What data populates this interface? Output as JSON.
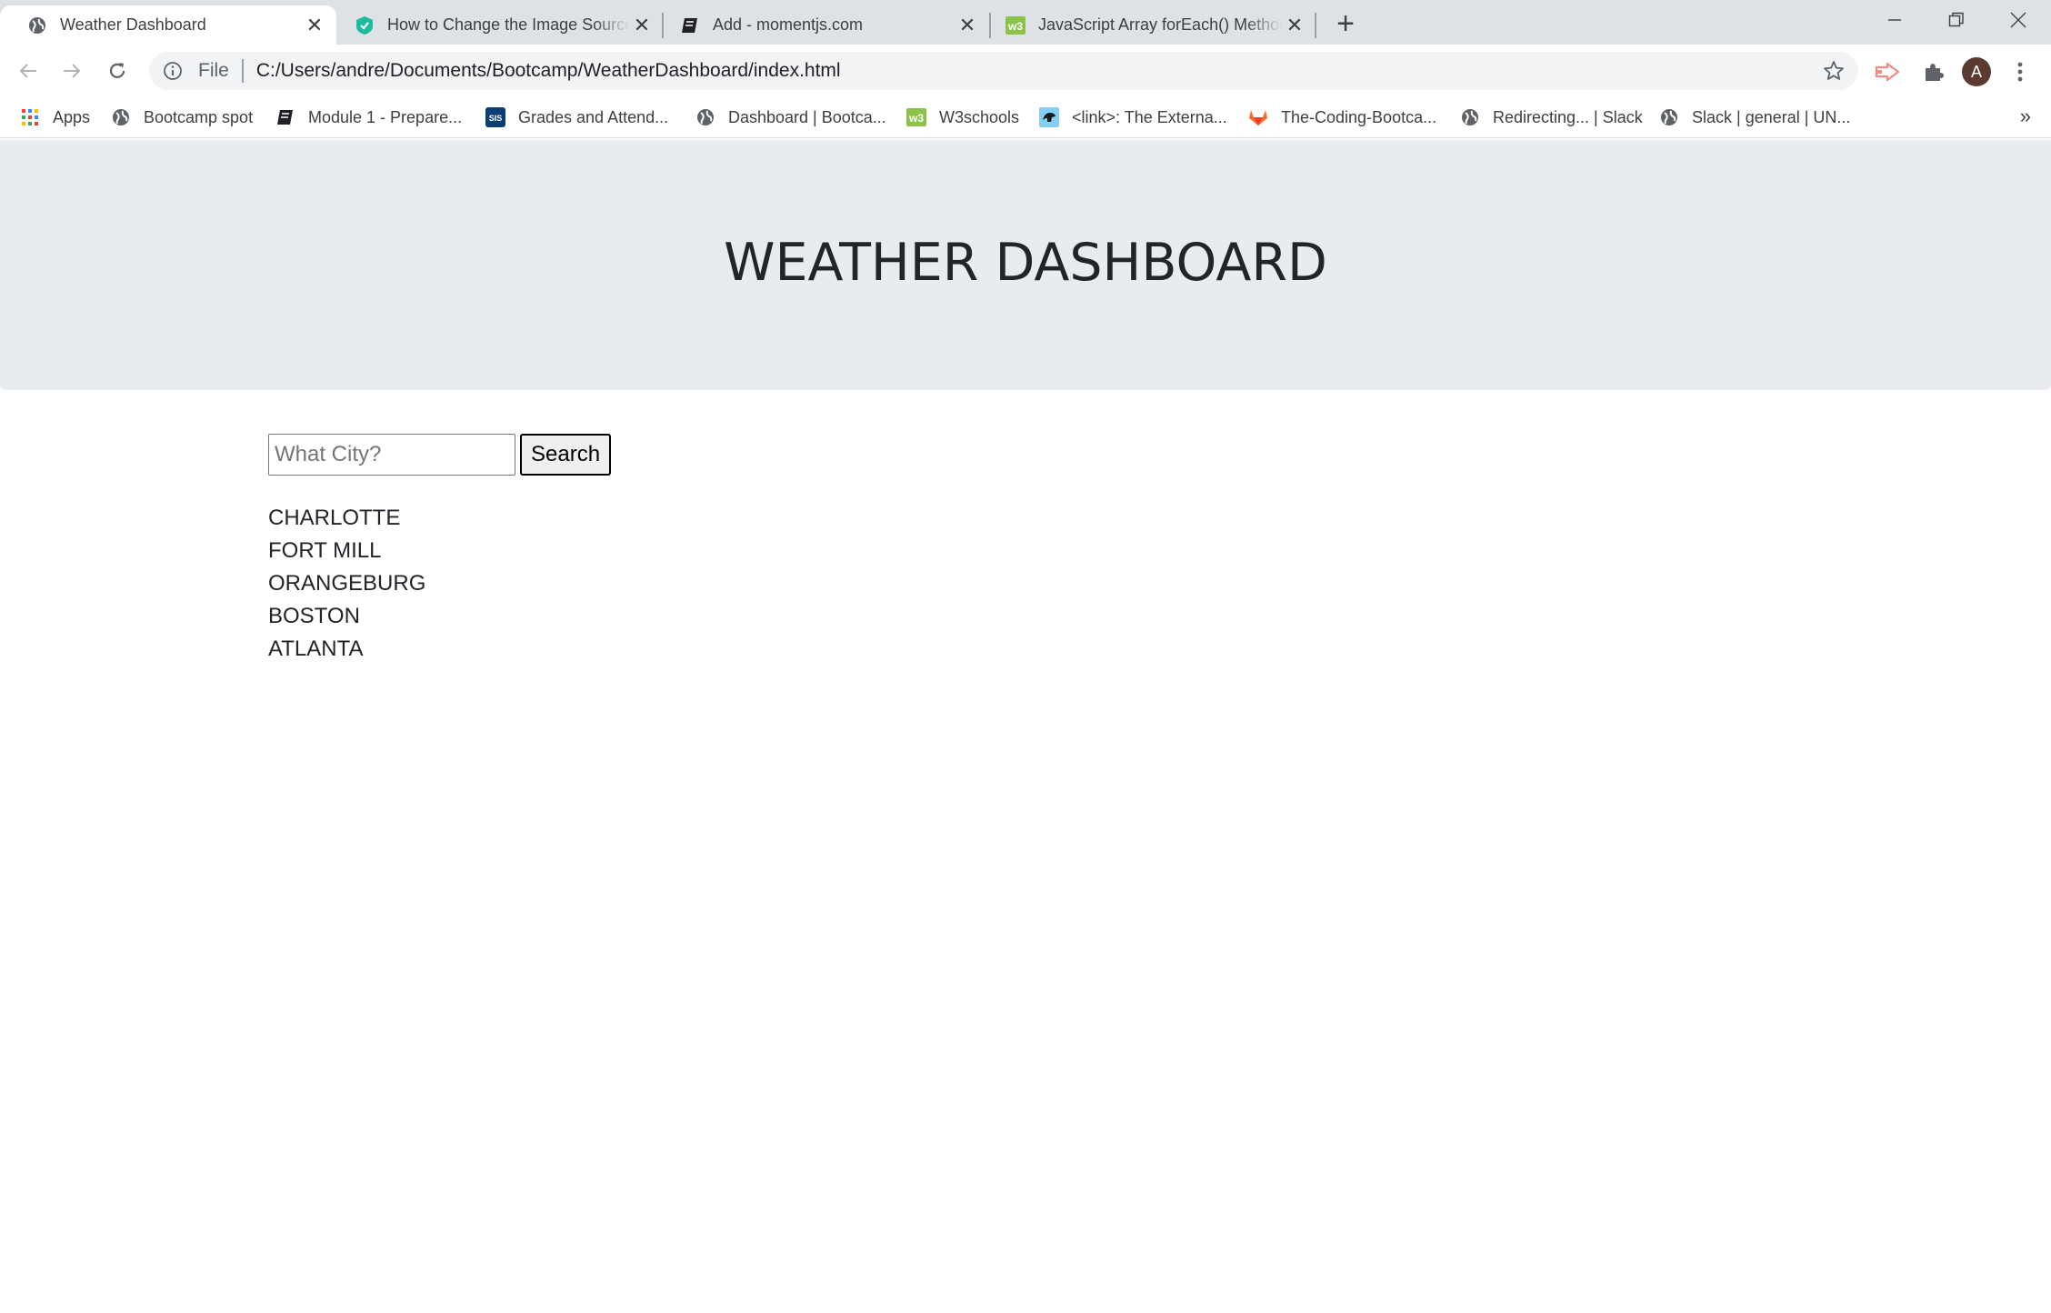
{
  "browser": {
    "tabs": [
      {
        "title": "Weather Dashboard",
        "favicon": "globe-icon",
        "active": true
      },
      {
        "title": "How to Change the Image Source",
        "favicon": "shield-icon",
        "active": false
      },
      {
        "title": "Add - momentjs.com",
        "favicon": "book-icon",
        "active": false
      },
      {
        "title": "JavaScript Array forEach() Method",
        "favicon": "w3-icon",
        "active": false
      }
    ],
    "address_bar": {
      "scheme_label": "File",
      "url": "C:/Users/andre/Documents/Bootcamp/WeatherDashboard/index.html"
    },
    "profile_initial": "A",
    "bookmarks": [
      {
        "label": "Apps",
        "icon": "apps-grid-icon"
      },
      {
        "label": "Bootcamp spot",
        "icon": "globe-icon"
      },
      {
        "label": "Module 1 - Prepare...",
        "icon": "book-icon"
      },
      {
        "label": "Grades and Attend...",
        "icon": "sis-icon"
      },
      {
        "label": "Dashboard | Bootca...",
        "icon": "globe-icon"
      },
      {
        "label": "W3schools",
        "icon": "w3-icon"
      },
      {
        "label": "<link>: The Externa...",
        "icon": "mdn-icon"
      },
      {
        "label": "The-Coding-Bootca...",
        "icon": "gitlab-icon"
      },
      {
        "label": "Redirecting... | Slack",
        "icon": "globe-icon"
      },
      {
        "label": "Slack | general | UN...",
        "icon": "globe-icon"
      }
    ],
    "bookmarks_overflow": "»"
  },
  "page": {
    "header_title": "WEATHER DASHBOARD",
    "search": {
      "placeholder": "What City?",
      "value": "",
      "button_label": "Search"
    },
    "cities": [
      "CHARLOTTE",
      "FORT MILL",
      "ORANGEBURG",
      "BOSTON",
      "ATLANTA"
    ]
  },
  "colors": {
    "tabstrip": "#dee1e6",
    "jumbotron": "#e9ecef",
    "text": "#212529"
  }
}
